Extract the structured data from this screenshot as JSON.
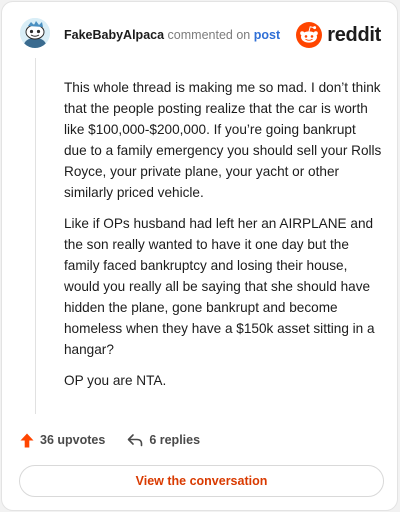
{
  "header": {
    "username": "FakeBabyAlpaca",
    "commented_text": "commented on",
    "post_link": "post",
    "logo_word": "reddit",
    "logo_icon": "reddit-snoo-icon",
    "avatar_icon": "snoo-avatar"
  },
  "comment": {
    "paragraphs": [
      "This whole thread is making me so mad. I don’t think that the people posting realize that the car is worth like $100,000-$200,000. If you’re going bankrupt due to a family emergency you should sell your Rolls Royce, your private plane, your yacht or other similarly priced vehicle.",
      "Like if OPs husband had left her an AIRPLANE and the son really wanted to have it one day but the family faced bankruptcy and losing their house, would you really all be saying that she should have hidden the plane, gone bankrupt and become homeless when they have a $150k asset sitting in a hangar?",
      "OP you are NTA."
    ]
  },
  "actions": {
    "upvotes": "36 upvotes",
    "replies": "6 replies",
    "upvote_icon": "upvote-arrow-icon",
    "reply_icon": "reply-arrow-icon"
  },
  "cta": {
    "label": "View the conversation"
  },
  "colors": {
    "brand": "#ff4500",
    "link": "#2f6fd6",
    "cta_text": "#d93a00",
    "text": "#1c1c1c",
    "muted": "#7c7c7c"
  }
}
